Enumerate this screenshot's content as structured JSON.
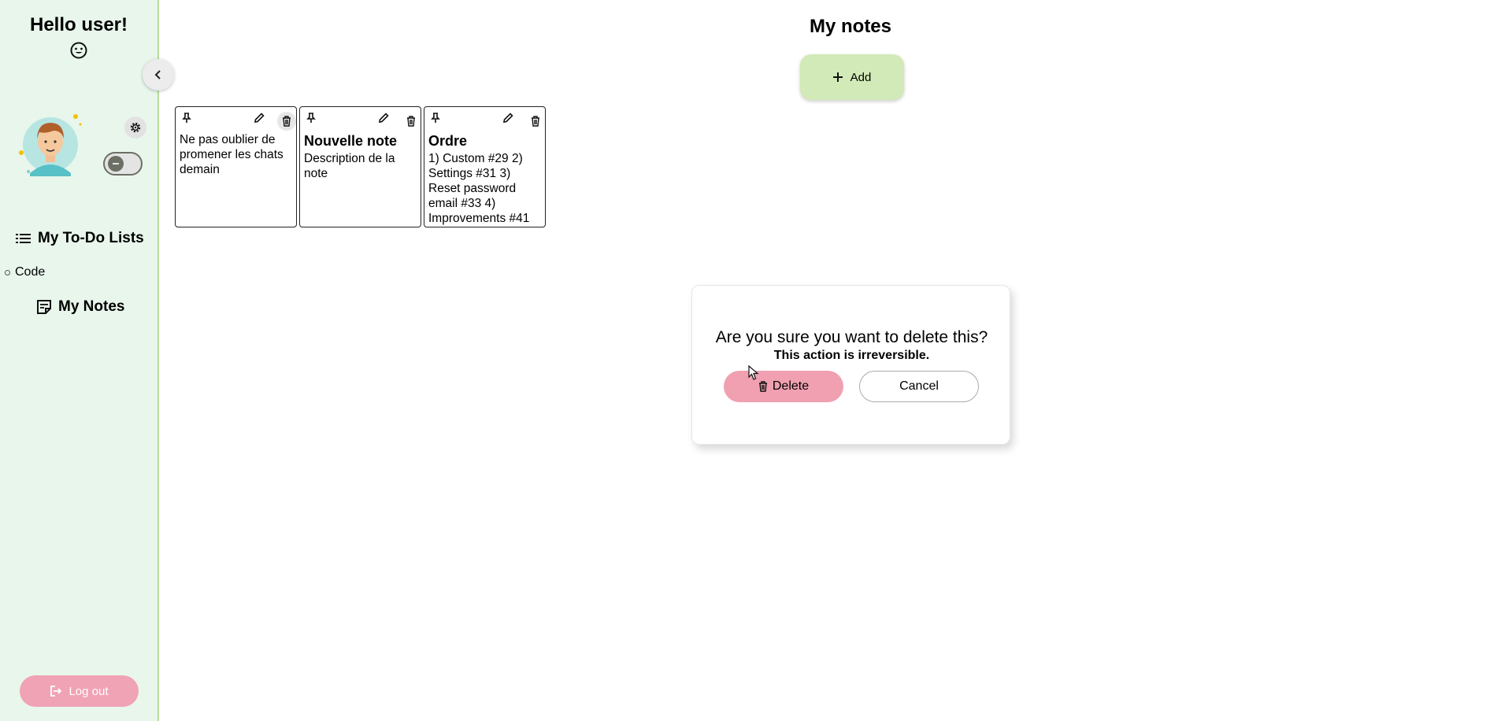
{
  "sidebar": {
    "greeting": "Hello user!",
    "nav": {
      "todo_label": "My To-Do Lists",
      "todo_items": [
        "Code"
      ],
      "notes_label": "My Notes"
    },
    "logout_label": "Log out",
    "theme_toggle": "off"
  },
  "main": {
    "title": "My notes",
    "add_label": "Add",
    "notes": [
      {
        "title": "",
        "body": "Ne pas oublier de promener les chats demain"
      },
      {
        "title": "Nouvelle note",
        "body": "Description de la note"
      },
      {
        "title": "Ordre",
        "body": "1) Custom #29 2) Settings #31 3) Reset password email #33 4) Improvements #41"
      }
    ]
  },
  "dialog": {
    "question": "Are you sure you want to delete this?",
    "warning": "This action is irreversible.",
    "delete_label": "Delete",
    "cancel_label": "Cancel"
  },
  "colors": {
    "sidebar_bg": "#e9f6ec",
    "accent_green": "#d2eab7",
    "accent_pink": "#f0a3b4"
  }
}
